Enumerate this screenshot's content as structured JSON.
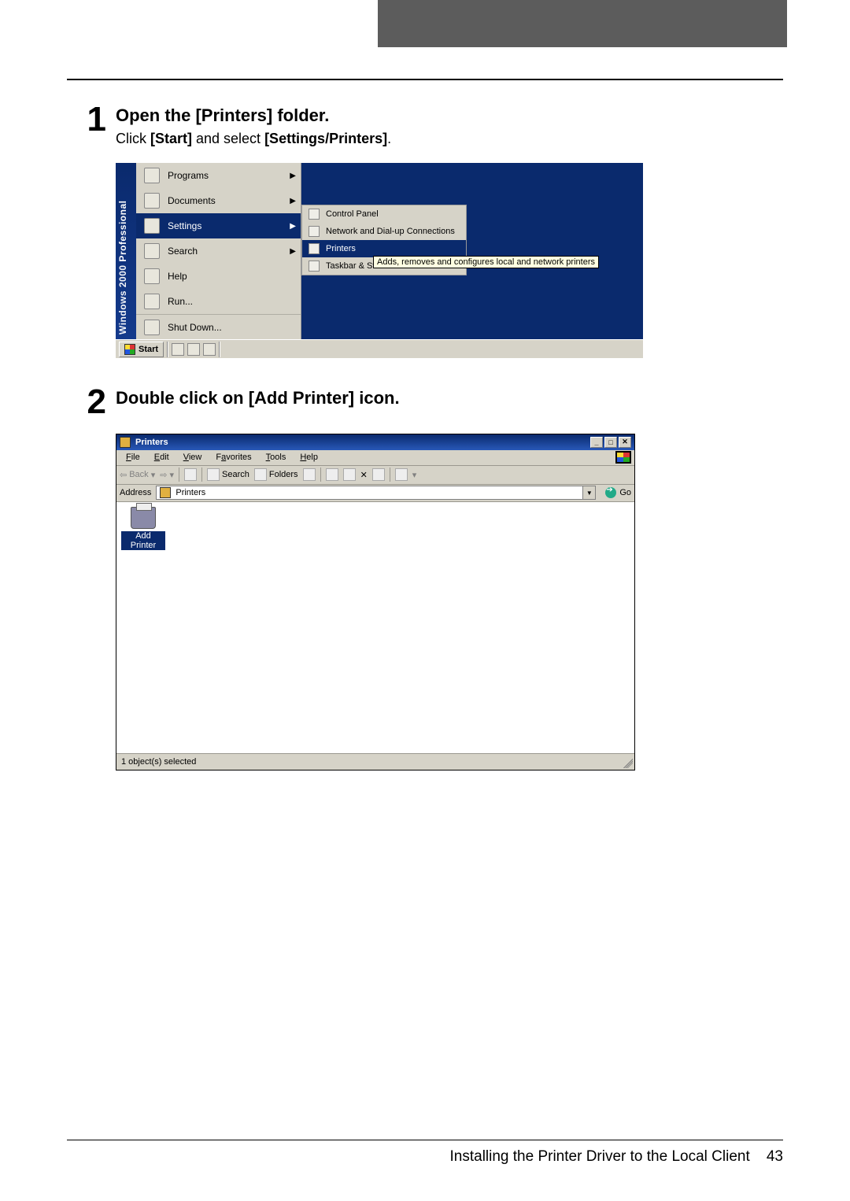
{
  "header_tab": "",
  "step1": {
    "num": "1",
    "title": "Open the [Printers] folder.",
    "desc_pre": "Click ",
    "desc_b1": "[Start]",
    "desc_mid": " and select ",
    "desc_b2": "[Settings/Printers]",
    "desc_post": "."
  },
  "startmenu": {
    "sidebar_top": "Professional",
    "sidebar_bottom": "Windows 2000",
    "items": [
      {
        "label": "Programs",
        "arrow": "▶"
      },
      {
        "label": "Documents",
        "arrow": "▶"
      },
      {
        "label": "Settings",
        "arrow": "▶",
        "selected": true
      },
      {
        "label": "Search",
        "arrow": "▶"
      },
      {
        "label": "Help"
      },
      {
        "label": "Run..."
      },
      {
        "label": "Shut Down..."
      }
    ],
    "submenu": [
      {
        "label": "Control Panel"
      },
      {
        "label": "Network and Dial-up Connections"
      },
      {
        "label": "Printers",
        "selected": true
      },
      {
        "label": "Taskbar & Start Menu..."
      }
    ],
    "tooltip": "Adds, removes and configures local and network printers",
    "start_label": "Start"
  },
  "step2": {
    "num": "2",
    "title": "Double click on [Add Printer] icon."
  },
  "printers_window": {
    "title": "Printers",
    "menus": [
      "File",
      "Edit",
      "View",
      "Favorites",
      "Tools",
      "Help"
    ],
    "toolbar": {
      "back": "Back",
      "search": "Search",
      "folders": "Folders"
    },
    "address_label": "Address",
    "address_value": "Printers",
    "go_label": "Go",
    "icon_label": "Add Printer",
    "status": "1 object(s) selected"
  },
  "footer": {
    "text": "Installing the Printer Driver to the Local Client",
    "page": "43"
  }
}
